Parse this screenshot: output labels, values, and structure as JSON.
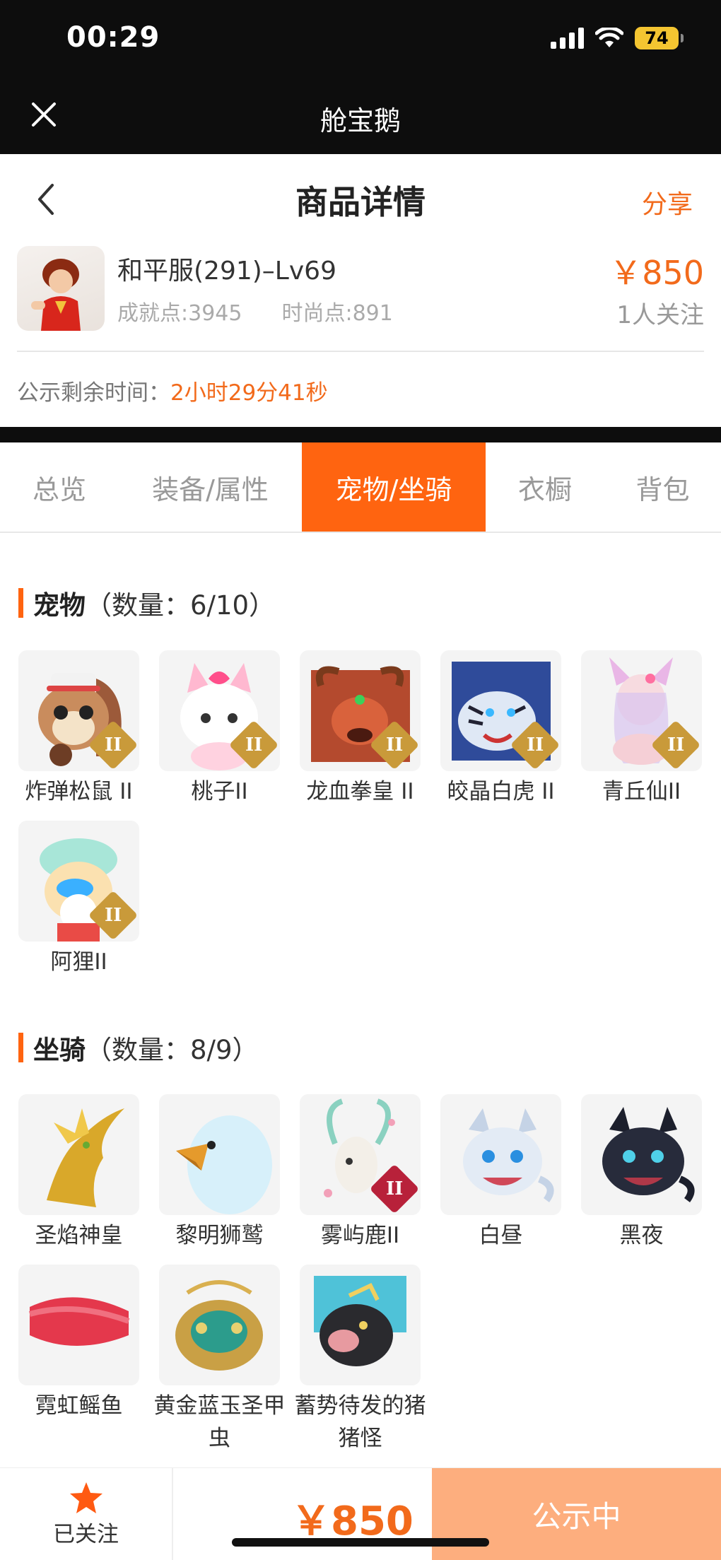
{
  "status": {
    "time": "00:29",
    "battery": "74"
  },
  "appbar": {
    "title": "舱宝鹅"
  },
  "header": {
    "title": "商品详情",
    "share": "分享"
  },
  "product": {
    "name": "和平服(291)–Lv69",
    "achievement": "成就点:3945",
    "fashion": "时尚点:891",
    "price": "￥850",
    "followers": "1人关注"
  },
  "public_time": {
    "label": "公示剩余时间：",
    "value": "2小时29分41秒"
  },
  "tabs": [
    {
      "label": "总览"
    },
    {
      "label": "装备/属性"
    },
    {
      "label": "宠物/坐骑"
    },
    {
      "label": "衣橱"
    },
    {
      "label": "背包"
    }
  ],
  "pets": {
    "title": "宠物",
    "count": "（数量：6/10）",
    "items": [
      {
        "name": "炸弹松鼠 II",
        "rank": "II"
      },
      {
        "name": "桃子II",
        "rank": "II"
      },
      {
        "name": "龙血拳皇 II",
        "rank": "II"
      },
      {
        "name": "皎晶白虎 II",
        "rank": "II"
      },
      {
        "name": "青丘仙II",
        "rank": "II"
      },
      {
        "name": "阿狸II",
        "rank": "II"
      }
    ]
  },
  "mounts": {
    "title": "坐骑",
    "count": "（数量：8/9）",
    "items": [
      {
        "name": "圣焰神皇"
      },
      {
        "name": "黎明狮鹫"
      },
      {
        "name": "雾屿鹿II",
        "rank": "II"
      },
      {
        "name": "白昼"
      },
      {
        "name": "黑夜"
      },
      {
        "name": "霓虹鳐鱼"
      },
      {
        "name": "黄金蓝玉圣甲虫"
      },
      {
        "name": "蓄势待发的猪猪怪"
      }
    ]
  },
  "bottom": {
    "follow_label": "已关注",
    "price": "￥850",
    "status": "公示中"
  },
  "colors": {
    "accent": "#ff6410",
    "price": "#f26a1b",
    "status_button": "#fdae7e"
  }
}
